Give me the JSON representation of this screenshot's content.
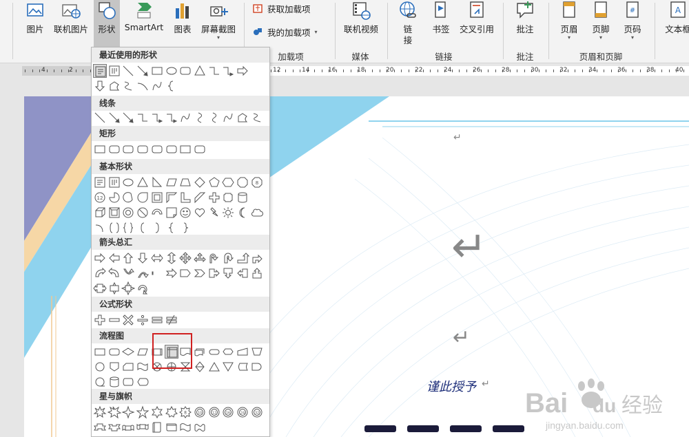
{
  "ribbon": {
    "buttons": [
      {
        "label": "图片",
        "icon": "picture-icon"
      },
      {
        "label": "联机图片",
        "icon": "online-picture-icon"
      },
      {
        "label": "形状",
        "icon": "shapes-icon"
      },
      {
        "label": "SmartArt",
        "icon": "smartart-icon"
      },
      {
        "label": "图表",
        "icon": "chart-icon"
      },
      {
        "label": "屏幕截图",
        "icon": "screenshot-icon"
      },
      {
        "label": "联机视频",
        "icon": "online-video-icon"
      },
      {
        "label": "链",
        "label2": "接",
        "icon": "link-icon"
      },
      {
        "label": "书签",
        "icon": "bookmark-icon"
      },
      {
        "label": "交叉引用",
        "icon": "cross-reference-icon"
      },
      {
        "label": "批注",
        "icon": "comment-icon"
      },
      {
        "label": "页眉",
        "icon": "header-icon"
      },
      {
        "label": "页脚",
        "icon": "footer-icon"
      },
      {
        "label": "页码",
        "icon": "page-number-icon"
      },
      {
        "label": "文本框",
        "icon": "textbox-icon"
      }
    ],
    "addins": {
      "get": "获取加载项",
      "mine": "我的加载项"
    },
    "groups": {
      "addins": "加载项",
      "media": "媒体",
      "links": "链接",
      "comments": "批注",
      "header_footer": "页眉和页脚"
    }
  },
  "ruler": {
    "labels": [
      "4",
      "2",
      "12",
      "14",
      "16",
      "18",
      "20",
      "22",
      "24",
      "26",
      "28",
      "30",
      "32",
      "34",
      "36",
      "38",
      "40"
    ]
  },
  "shapes_panel": {
    "sections": [
      "最近使用的形状",
      "线条",
      "矩形",
      "基本形状",
      "箭头总汇",
      "公式形状",
      "流程图",
      "星与旗帜"
    ]
  },
  "document": {
    "text": "谨此授予",
    "colors": {
      "accent_blue": "#8fd3ee",
      "periwinkle": "#8f93c6",
      "peach": "#f6d7a6",
      "text": "#1e2f7a"
    }
  },
  "watermark": {
    "brand": "Bai",
    "brand2": "du",
    "cn": "经验",
    "url": "jingyan.baidu.com"
  }
}
